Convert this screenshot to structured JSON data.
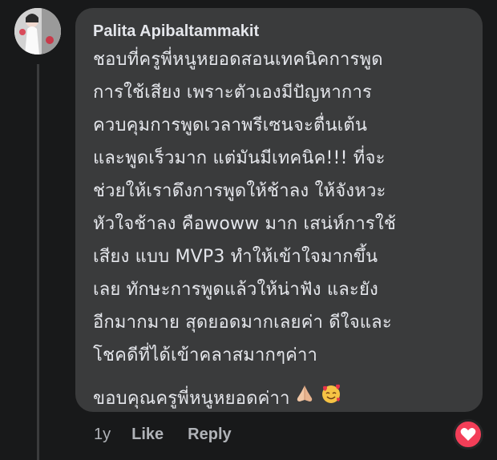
{
  "comment": {
    "author": "Palita Apibaltammakit",
    "avatar_icon": "profile-photo",
    "lines": [
      "ชอบที่ครูพี่หนูหยอดสอนเทคนิคการพูด",
      "การใช้เสียง เพราะตัวเองมีปัญหาการ",
      "ควบคุมการพูดเวลาพรีเซนจะตื่นเต้น",
      "และพูดเร็วมาก แต่มันมีเทคนิค!!! ที่จะ",
      "ช่วยให้เราดึงการพูดให้ช้าลง ให้จังหวะ",
      "หัวใจช้าลง คือwoww มาก เสน่ห์การใช้",
      "เสียง แบบ MVP3 ทำให้เข้าใจมากขึ้น",
      "เลย ทักษะการพูดแล้วให้น่าฟัง และยัง",
      "อีกมากมาย สุดยอดมากเลยค่า ดีใจและ",
      "โชคดีที่ได้เข้าคลาสมากๆค่าา"
    ],
    "last_line": "ขอบคุณครูพี่หนูหยอดค่าา",
    "emojis": [
      "folded-hands-icon",
      "smiling-face-with-hearts-icon"
    ]
  },
  "actions": {
    "timestamp": "1y",
    "like_label": "Like",
    "reply_label": "Reply"
  },
  "reaction": {
    "icon": "heart-icon",
    "color": "#f33e58"
  },
  "colors": {
    "background": "#18191a",
    "bubble": "#3a3b3c",
    "text": "#e4e6eb",
    "secondary_text": "#b0b3b8"
  }
}
